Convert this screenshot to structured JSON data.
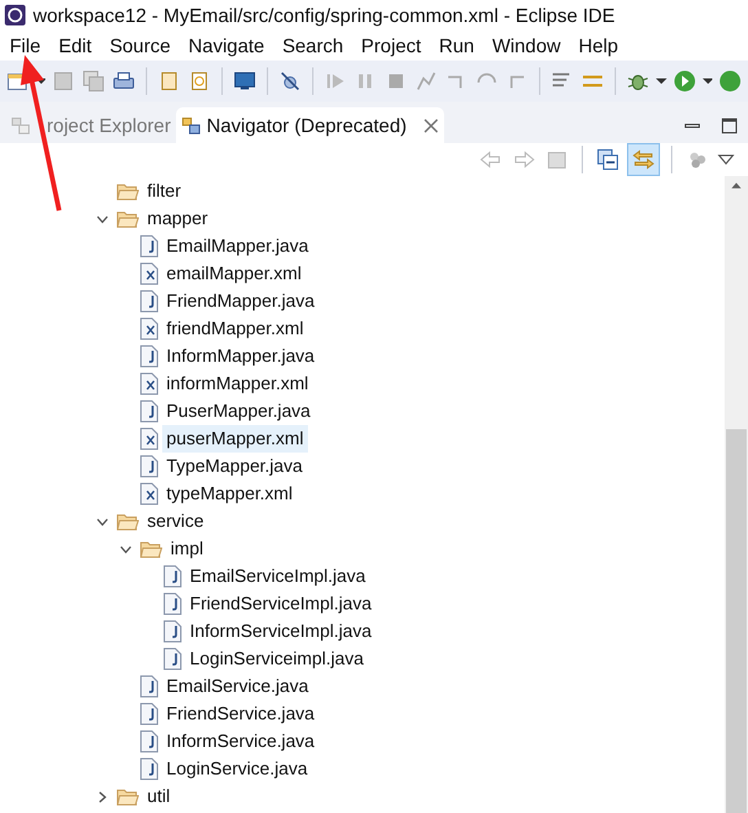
{
  "window": {
    "title": "workspace12 - MyEmail/src/config/spring-common.xml - Eclipse IDE"
  },
  "menu": [
    "File",
    "Edit",
    "Source",
    "Navigate",
    "Search",
    "Project",
    "Run",
    "Window",
    "Help"
  ],
  "tabs": [
    {
      "label": "roject Explorer",
      "selected": false
    },
    {
      "label": "Navigator (Deprecated)",
      "selected": true
    }
  ],
  "view_toolbar": {
    "link_with_editor": true
  },
  "tree": [
    {
      "label": "filter",
      "kind": "empty-folder",
      "selected": false
    },
    {
      "label": "mapper",
      "kind": "folder",
      "expanded": true,
      "selected": false,
      "children": [
        {
          "label": "EmailMapper.java",
          "kind": "java",
          "selected": false
        },
        {
          "label": "emailMapper.xml",
          "kind": "xml",
          "selected": false
        },
        {
          "label": "FriendMapper.java",
          "kind": "java",
          "selected": false
        },
        {
          "label": "friendMapper.xml",
          "kind": "xml",
          "selected": false
        },
        {
          "label": "InformMapper.java",
          "kind": "java",
          "selected": false
        },
        {
          "label": "informMapper.xml",
          "kind": "xml",
          "selected": false
        },
        {
          "label": "PuserMapper.java",
          "kind": "java",
          "selected": false
        },
        {
          "label": "puserMapper.xml",
          "kind": "xml",
          "selected": true
        },
        {
          "label": "TypeMapper.java",
          "kind": "java",
          "selected": false
        },
        {
          "label": "typeMapper.xml",
          "kind": "xml",
          "selected": false
        }
      ]
    },
    {
      "label": "service",
      "kind": "folder",
      "expanded": true,
      "selected": false,
      "children": [
        {
          "label": "impl",
          "kind": "folder",
          "expanded": true,
          "selected": false,
          "children": [
            {
              "label": "EmailServiceImpl.java",
              "kind": "java",
              "selected": false
            },
            {
              "label": "FriendServiceImpl.java",
              "kind": "java",
              "selected": false
            },
            {
              "label": "InformServiceImpl.java",
              "kind": "java",
              "selected": false
            },
            {
              "label": "LoginServiceimpl.java",
              "kind": "java",
              "selected": false
            }
          ]
        },
        {
          "label": "EmailService.java",
          "kind": "java",
          "selected": false
        },
        {
          "label": "FriendService.java",
          "kind": "java",
          "selected": false
        },
        {
          "label": "InformService.java",
          "kind": "java",
          "selected": false
        },
        {
          "label": "LoginService.java",
          "kind": "java",
          "selected": false
        }
      ]
    },
    {
      "label": "util",
      "kind": "folder",
      "expanded": false,
      "selected": false
    }
  ]
}
